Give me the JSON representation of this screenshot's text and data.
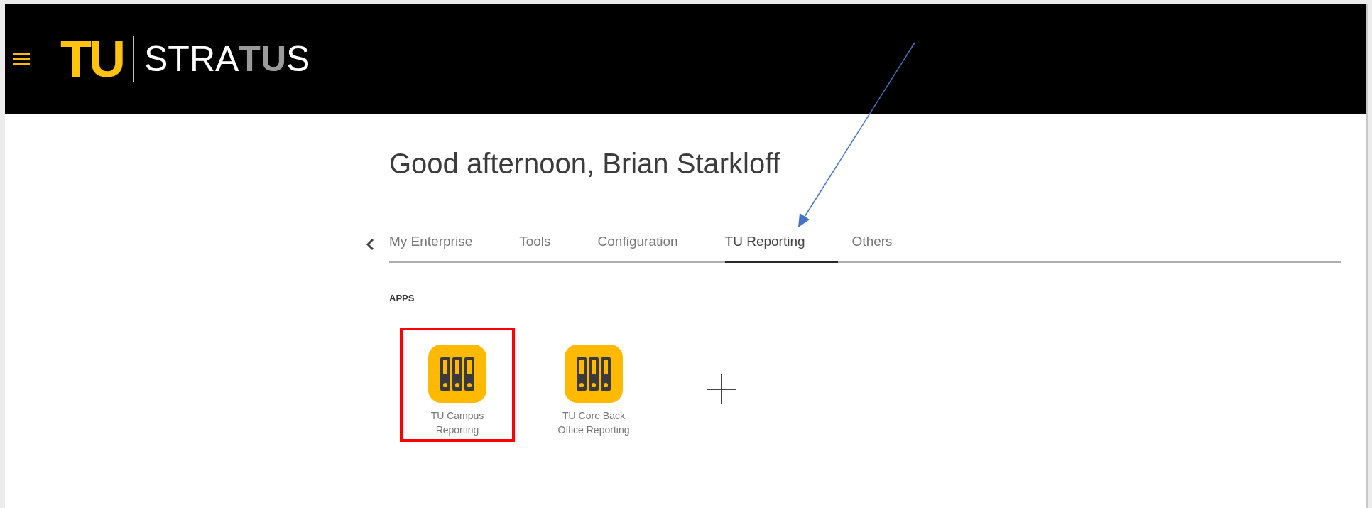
{
  "header": {
    "logo_mark": "TU",
    "logo_name": [
      {
        "text": "STRA",
        "muted": false
      },
      {
        "text": "TU",
        "muted": true
      },
      {
        "text": "S",
        "muted": false
      }
    ]
  },
  "greeting": "Good afternoon, Brian Starkloff",
  "tabs": [
    {
      "label": "My Enterprise",
      "selected": false
    },
    {
      "label": "Tools",
      "selected": false
    },
    {
      "label": "Configuration",
      "selected": false
    },
    {
      "label": "TU Reporting",
      "selected": true
    },
    {
      "label": "Others",
      "selected": false
    }
  ],
  "apps_heading": "APPS",
  "apps": [
    {
      "kind": "app",
      "label": "TU Campus Reporting",
      "highlighted": true
    },
    {
      "kind": "app",
      "label": "TU Core Back Office Reporting",
      "highlighted": false
    },
    {
      "kind": "add"
    }
  ]
}
